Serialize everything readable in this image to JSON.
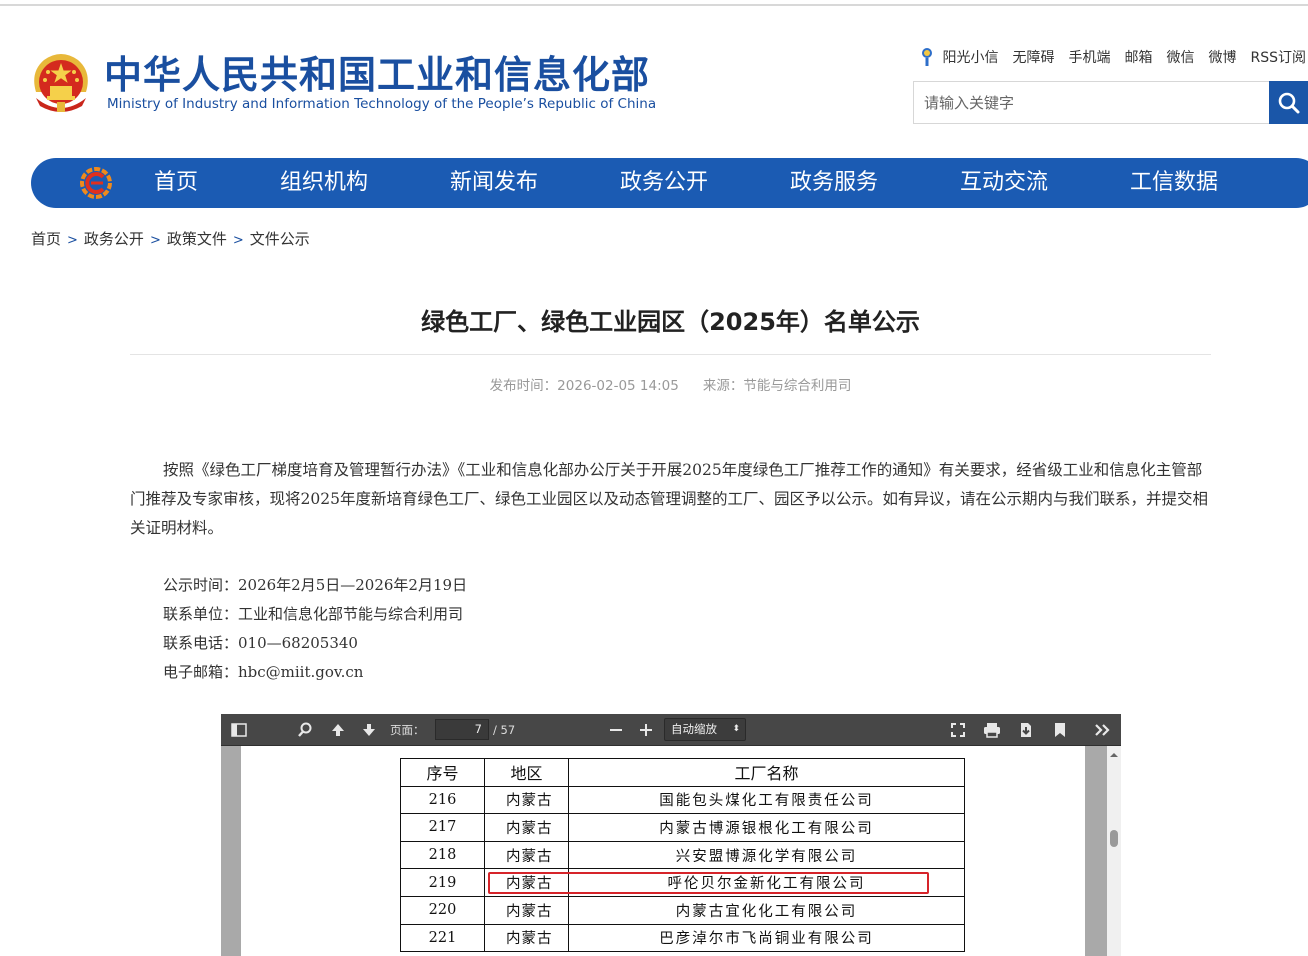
{
  "site": {
    "title": "中华人民共和国工业和信息化部",
    "subtitle": "Ministry of Industry and Information Technology of the People’s Republic of China"
  },
  "quicklinks": [
    "阳光小信",
    "无障碍",
    "手机端",
    "邮箱",
    "微信",
    "微博",
    "RSS订阅"
  ],
  "search": {
    "placeholder": "请输入关键字"
  },
  "nav": [
    "首页",
    "组织机构",
    "新闻发布",
    "政务公开",
    "政务服务",
    "互动交流",
    "工信数据"
  ],
  "breadcrumb": [
    "首页",
    "政务公开",
    "政策文件",
    "文件公示"
  ],
  "breadcrumb_sep": ">",
  "article": {
    "title": "绿色工厂、绿色工业园区（2025年）名单公示",
    "publish_time": "发布时间：2026-02-05 14:05",
    "source": "来源：节能与综合利用司",
    "body": "按照《绿色工厂梯度培育及管理暂行办法》《工业和信息化部办公厅关于开展2025年度绿色工厂推荐工作的通知》有关要求，经省级工业和信息化主管部门推荐及专家审核，现将2025年度新培育绿色工厂、绿色工业园区以及动态管理调整的工厂、园区予以公示。如有异议，请在公示期内与我们联系，并提交相关证明材料。",
    "contact": [
      "公示时间：2026年2月5日—2026年2月19日",
      "联系单位：工业和信息化部节能与综合利用司",
      "联系电话：010—68205340",
      "电子邮箱：hbc@miit.gov.cn"
    ]
  },
  "pdf_viewer": {
    "page_label": "页面：",
    "current_page": "7",
    "total_pages": "/ 57",
    "zoom": "自动缩放",
    "table": {
      "headers": [
        "序号",
        "地区",
        "工厂名称"
      ],
      "rows": [
        [
          "216",
          "内蒙古",
          "国能包头煤化工有限责任公司"
        ],
        [
          "217",
          "内蒙古",
          "内蒙古博源银根化工有限公司"
        ],
        [
          "218",
          "内蒙古",
          "兴安盟博源化学有限公司"
        ],
        [
          "219",
          "内蒙古",
          "呼伦贝尔金新化工有限公司"
        ],
        [
          "220",
          "内蒙古",
          "内蒙古宜化化工有限公司"
        ],
        [
          "221",
          "内蒙古",
          "巴彦淖尔市飞尚铜业有限公司"
        ]
      ],
      "highlighted_row": "219"
    }
  },
  "colors": {
    "brand_blue": "#1b5bb3",
    "highlight_red": "#d6242a"
  }
}
